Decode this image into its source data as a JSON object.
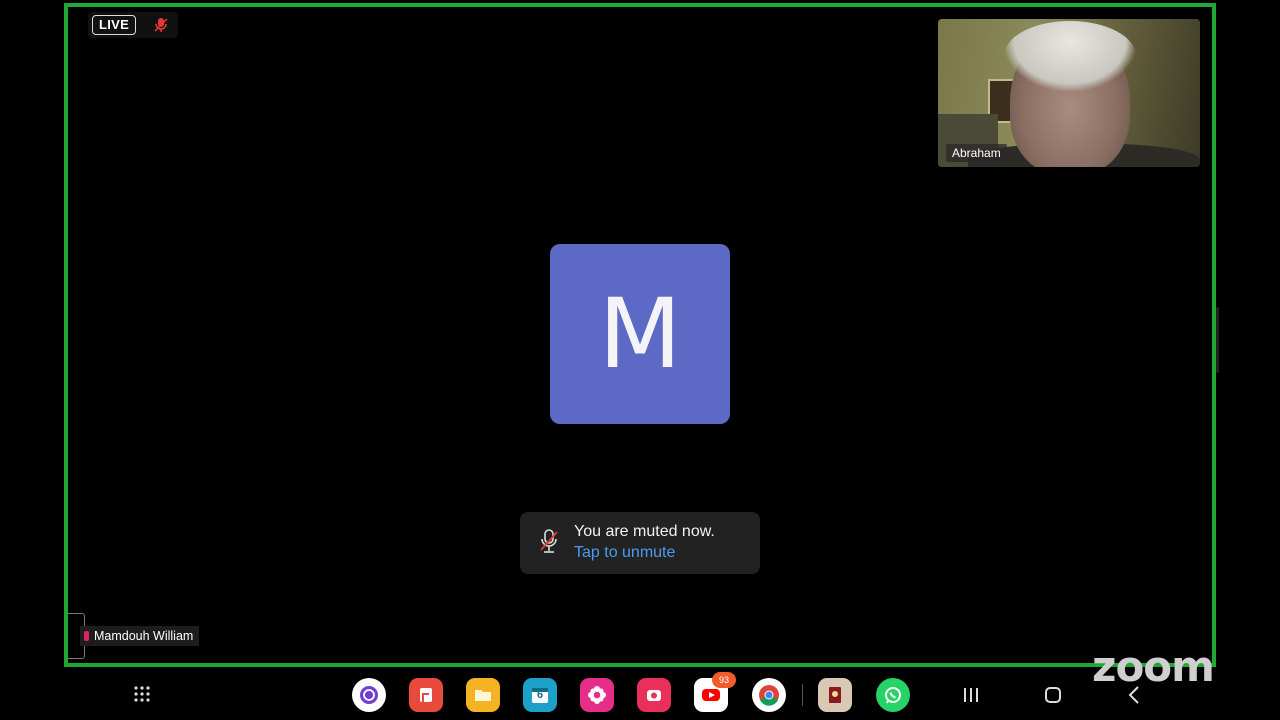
{
  "meeting": {
    "live_label": "LIVE",
    "self_view_name": "Abraham",
    "active_speaker_initial": "M",
    "active_speaker_color": "#5d6ac5",
    "participant_name": "Mamdouh William",
    "toast": {
      "message": "You are muted now.",
      "action": "Tap to unmute"
    },
    "watermark": "zoom",
    "frame_color": "#1fa832"
  },
  "taskbar": {
    "apps": [
      {
        "name": "Galaxy Store",
        "icon": "store-icon",
        "color": "#ffffff"
      },
      {
        "name": "Samsung Notes",
        "icon": "notes-icon",
        "color": "#e84b3c"
      },
      {
        "name": "My Files",
        "icon": "folder-icon",
        "color": "#f5b324"
      },
      {
        "name": "Calendar",
        "icon": "calendar-icon",
        "color": "#1da1c8",
        "value": "6"
      },
      {
        "name": "Blossom",
        "icon": "flower-icon",
        "color": "#e52e8a"
      },
      {
        "name": "Screen Recorder",
        "icon": "camera-icon",
        "color": "#e8305a"
      },
      {
        "name": "YouTube",
        "icon": "youtube-icon",
        "color": "#ffffff",
        "badge": "93"
      },
      {
        "name": "Chrome",
        "icon": "chrome-icon",
        "color": "#ffffff"
      },
      {
        "name": "App",
        "icon": "app-icon",
        "color": "#d9c9b4"
      },
      {
        "name": "WhatsApp",
        "icon": "whatsapp-icon",
        "color": "#25d366"
      }
    ],
    "nav": [
      "recents-icon",
      "home-icon",
      "back-icon"
    ]
  }
}
